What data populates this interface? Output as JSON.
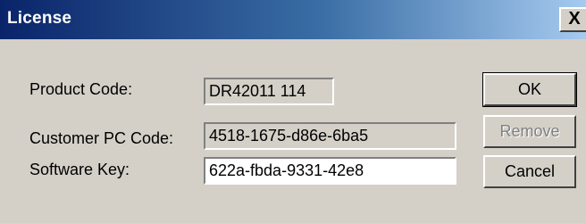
{
  "window": {
    "title": "License",
    "close_glyph": "×",
    "close_label": "X"
  },
  "labels": {
    "product_code": "Product Code:",
    "customer_pc_code": "Customer PC Code:",
    "software_key": "Software Key:"
  },
  "fields": {
    "product_code_value": "DR42011 114",
    "customer_pc_code_value": "4518-1675-d86e-6ba5",
    "software_key_value": "622a-fbda-9331-42e8"
  },
  "buttons": {
    "ok": "OK",
    "remove": "Remove",
    "cancel": "Cancel"
  },
  "colors": {
    "title_bar_start": "#0a246a",
    "title_bar_end": "#a6caf0",
    "dialog_background": "#d4d0c8",
    "disabled_text": "#808080"
  }
}
